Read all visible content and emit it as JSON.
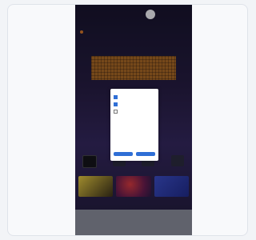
{
  "header": {
    "left_text": "",
    "right_text": ""
  },
  "page": {
    "headline": ""
  },
  "categories": [
    {
      "label": ""
    },
    {
      "label": ""
    },
    {
      "label": ""
    },
    {
      "label": ""
    }
  ],
  "footer": {
    "col1_title": "",
    "col2_title": "",
    "col3_title": ""
  },
  "modal": {
    "title": "",
    "subtitle": "",
    "options": [
      {
        "label": "",
        "checked": true
      },
      {
        "label": "",
        "checked": true
      },
      {
        "label": "",
        "checked": false
      }
    ],
    "button_left": "",
    "button_right": ""
  },
  "colors": {
    "accent": "#2f6fd6",
    "band": "#b06a1e",
    "footer": "#8f929c"
  }
}
